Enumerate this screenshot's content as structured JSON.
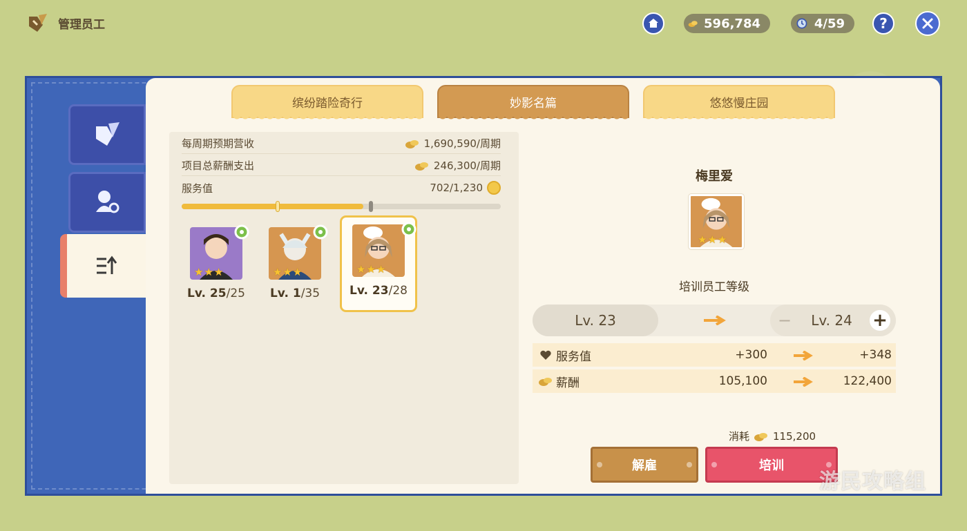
{
  "header": {
    "title": "管理员工",
    "money": "596,784",
    "staff_count": "4/59",
    "help_label": "?"
  },
  "tabs": [
    {
      "label": "缤纷踏险奇行",
      "active": false
    },
    {
      "label": "妙影名篇",
      "active": true
    },
    {
      "label": "悠悠慢庄园",
      "active": false
    }
  ],
  "stats": {
    "weekly_revenue_label": "每周期预期营收",
    "weekly_revenue_value": "1,690,590/周期",
    "salary_label": "项目总薪酬支出",
    "salary_value": "246,300/周期",
    "service_label": "服务值",
    "service_value": "702/1,230",
    "service_progress": 0.57
  },
  "employees": [
    {
      "level": "Lv. 25",
      "max": "/25",
      "stars": 3,
      "selected": false
    },
    {
      "level": "Lv. 1",
      "max": "/35",
      "stars": 3,
      "selected": false
    },
    {
      "level": "Lv. 23",
      "max": "/28",
      "stars": 3,
      "selected": true
    }
  ],
  "detail": {
    "name": "梅里爱",
    "train_title": "培训员工等级",
    "current_level": "Lv. 23",
    "next_level": "Lv. 24",
    "minus": "−",
    "plus": "+",
    "attrs": [
      {
        "label": "服务值",
        "from": "+300",
        "to": "+348",
        "icon": "heart-icon"
      },
      {
        "label": "薪酬",
        "from": "105,100",
        "to": "122,400",
        "icon": "coin-icon"
      }
    ],
    "consume_label": "消耗",
    "consume_value": "115,200",
    "dismiss_label": "解雇",
    "train_label": "培训"
  },
  "watermark": "游民攻略组",
  "colors": {
    "frame_blue": "#3f66b8",
    "tab_active": "#d39a52",
    "train_button": "#e8546a",
    "dismiss_button": "#c8914a"
  }
}
